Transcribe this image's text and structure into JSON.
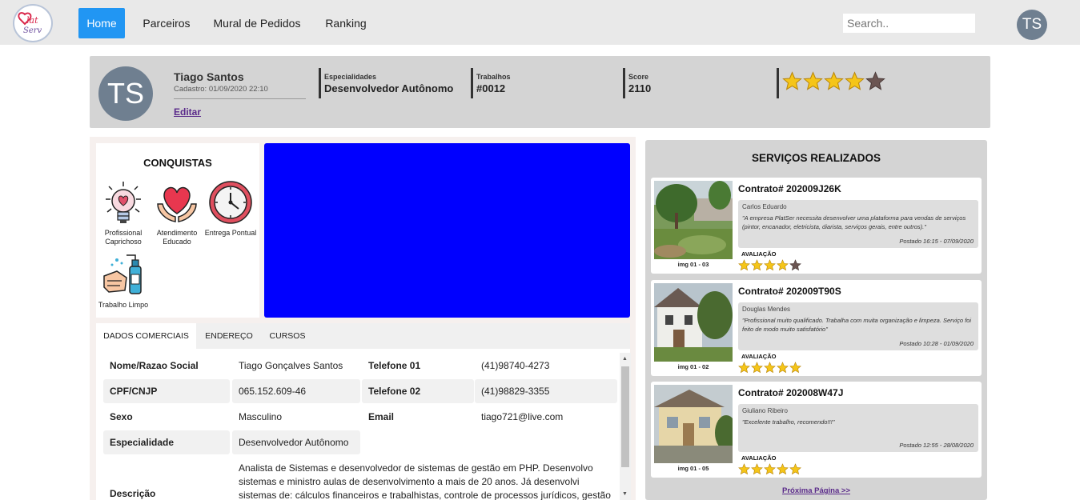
{
  "nav": {
    "logo_text": "Plat Serv",
    "items": [
      {
        "label": "Home",
        "active": true
      },
      {
        "label": "Parceiros",
        "active": false
      },
      {
        "label": "Mural de Pedidos",
        "active": false
      },
      {
        "label": "Ranking",
        "active": false
      }
    ],
    "search_placeholder": "Search..",
    "avatar": "TS"
  },
  "profile": {
    "avatar": "TS",
    "name": "Tiago Santos",
    "cadastro": "Cadastro: 01/09/2020 22:10",
    "edit": "Editar",
    "stats": [
      {
        "label": "Especialidades",
        "value": "Desenvolvedor Autônomo"
      },
      {
        "label": "Trabalhos",
        "value": "#0012"
      },
      {
        "label": "Score",
        "value": "2110"
      }
    ],
    "rating": 4,
    "rating_max": 5
  },
  "conquistas": {
    "title": "CONQUISTAS",
    "badges": [
      {
        "label": "Profissional Caprichoso",
        "icon": "lightbulb-heart-icon"
      },
      {
        "label": "Atendimento Educado",
        "icon": "hands-heart-icon"
      },
      {
        "label": "Entrega Pontual",
        "icon": "clock-icon"
      },
      {
        "label": "Trabalho Limpo",
        "icon": "hand-sanitizer-icon"
      }
    ]
  },
  "tabs": [
    {
      "label": "DADOS COMERCIAIS",
      "active": true
    },
    {
      "label": "ENDEREÇO",
      "active": false
    },
    {
      "label": "CURSOS",
      "active": false
    }
  ],
  "details": {
    "nome_label": "Nome/Razao Social",
    "nome": "Tiago Gonçalves Santos",
    "tel1_label": "Telefone 01",
    "tel1": "(41)98740-4273",
    "cpf_label": "CPF/CNJP",
    "cpf": "065.152.609-46",
    "tel2_label": "Telefone 02",
    "tel2": "(41)98829-3355",
    "sexo_label": "Sexo",
    "sexo": "Masculino",
    "email_label": "Email",
    "email": "tiago721@live.com",
    "esp_label": "Especialidade",
    "esp": "Desenvolvedor Autônomo",
    "desc_label": "Descrição",
    "desc": "Analista de Sistemas e desenvolvedor de sistemas de gestão em PHP. Desenvolvo sistemas e ministro aulas de desenvolvimento a mais de 20 anos. Já desenvolvi sistemas de: cálculos financeiros e trabalhistas, controle de processos jurídicos, gestão de"
  },
  "servicos": {
    "title": "SERVIÇOS REALIZADOS",
    "aval_label": "AVALIAÇÃO",
    "next": "Próxima Página >>",
    "items": [
      {
        "contract": "Contrato# 202009J26K",
        "caption": "img 01 - 03",
        "author": "Carlos Eduardo",
        "text": "\"A empresa PlatSer necessita desenvolver uma plataforma para vendas de serviços (pintor, encanador, eletricista, diarista, serviços gerais, entre outros).\"",
        "date": "Postado 16:15 - 07/09/2020",
        "rating": 4
      },
      {
        "contract": "Contrato# 202009T90S",
        "caption": "img 01 - 02",
        "author": "Douglas Mendes",
        "text": "\"Profissional muito qualificado. Trabalha com muita organização e limpeza. Serviço foi feito de modo muito satisfatório\"",
        "date": "Postado 10:28 - 01/09/2020",
        "rating": 5
      },
      {
        "contract": "Contrato# 202008W47J",
        "caption": "img 01 - 05",
        "author": "Giuliano Ribeiro",
        "text": "\"Excelente trabalho, recomendo!!!\"",
        "date": "Postado 12:55 - 28/08/2020",
        "rating": 5
      }
    ]
  }
}
